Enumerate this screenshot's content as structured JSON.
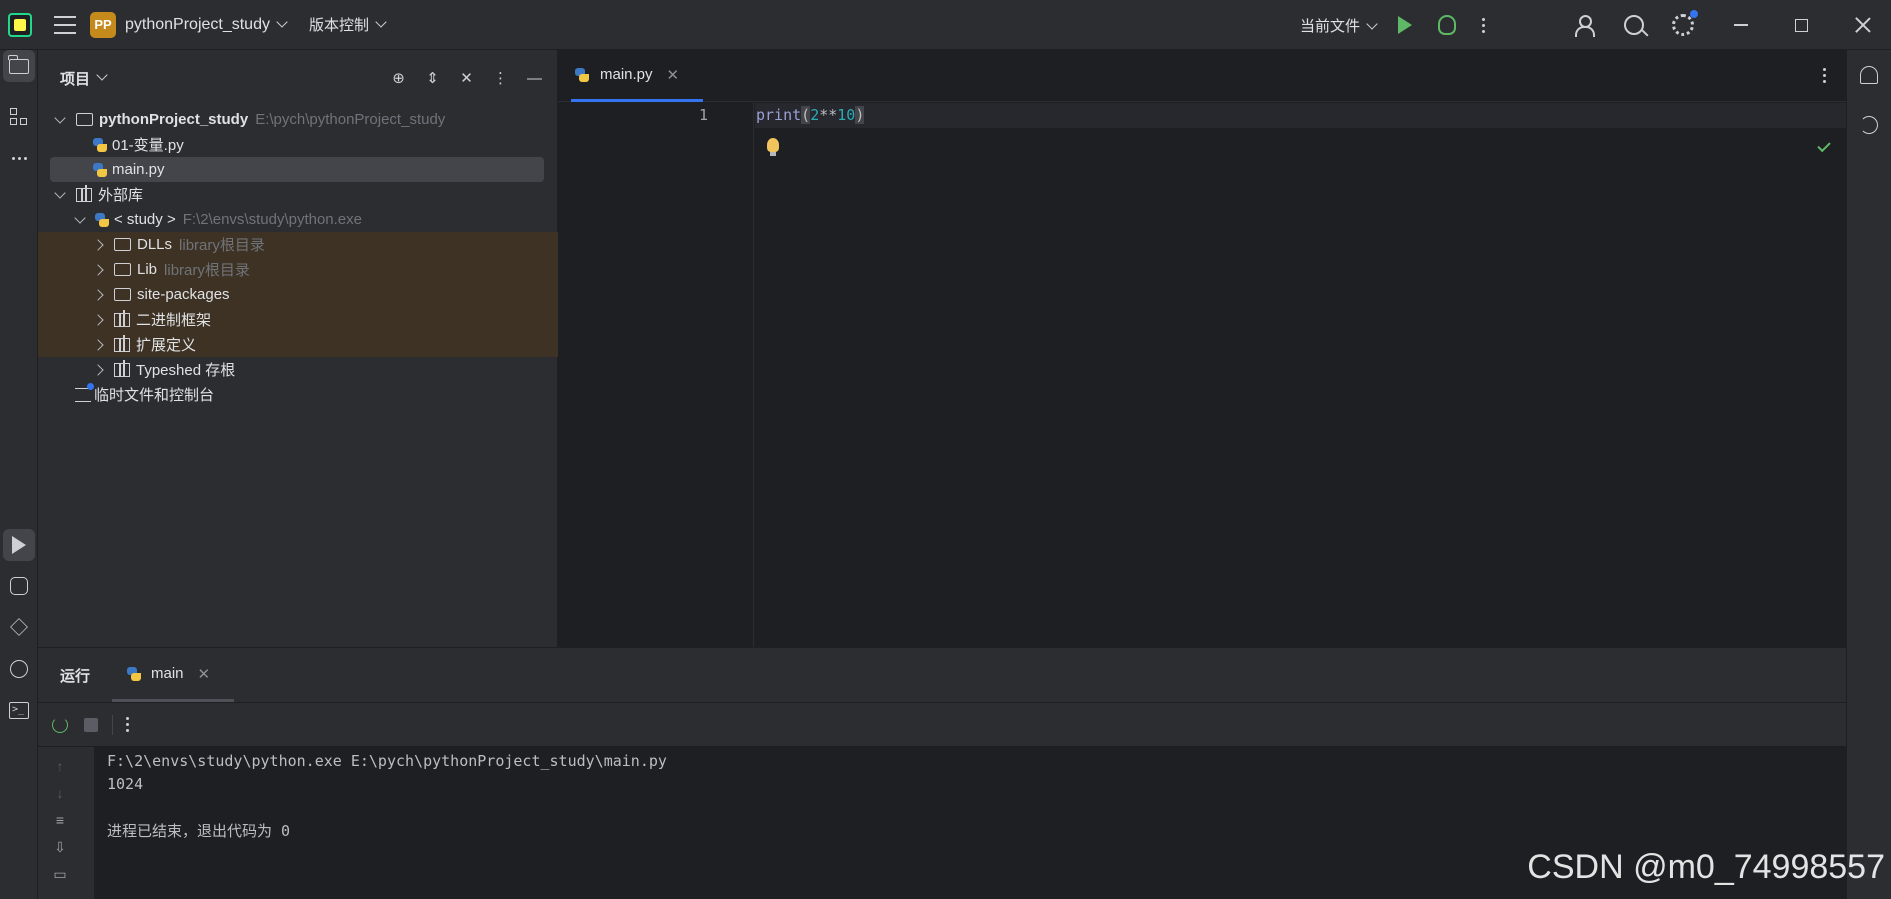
{
  "titlebar": {
    "project_badge": "PP",
    "project_name": "pythonProject_study",
    "vcs_label": "版本控制",
    "run_config": "当前文件"
  },
  "project_panel": {
    "title": "项目",
    "tree": [
      {
        "label": "pythonProject_study",
        "hint": "E:\\pych\\pythonProject_study"
      },
      {
        "label": "01-变量.py"
      },
      {
        "label": "main.py"
      },
      {
        "label": "外部库"
      },
      {
        "label": "< study >",
        "hint": "F:\\2\\envs\\study\\python.exe"
      },
      {
        "label": "DLLs",
        "hint": "library根目录"
      },
      {
        "label": "Lib",
        "hint": "library根目录"
      },
      {
        "label": "site-packages"
      },
      {
        "label": "二进制框架"
      },
      {
        "label": "扩展定义"
      },
      {
        "label": "Typeshed 存根"
      },
      {
        "label": "临时文件和控制台"
      }
    ]
  },
  "editor": {
    "tab_label": "main.py",
    "line_number": "1",
    "code": {
      "fn": "print",
      "open": "(",
      "num1": "2",
      "op": "**",
      "num2": "10",
      "close": ")"
    }
  },
  "run_panel": {
    "title": "运行",
    "tab_label": "main",
    "console_lines": [
      "F:\\2\\envs\\study\\python.exe E:\\pych\\pythonProject_study\\main.py",
      "1024",
      "",
      "进程已结束，退出代码为 0"
    ]
  },
  "watermark": "CSDN @m0_74998557",
  "colors": {
    "accent": "#3574f0",
    "run_green": "#5fb865",
    "library_highlight": "#3d3223",
    "project_badge": "#c48a1c"
  }
}
